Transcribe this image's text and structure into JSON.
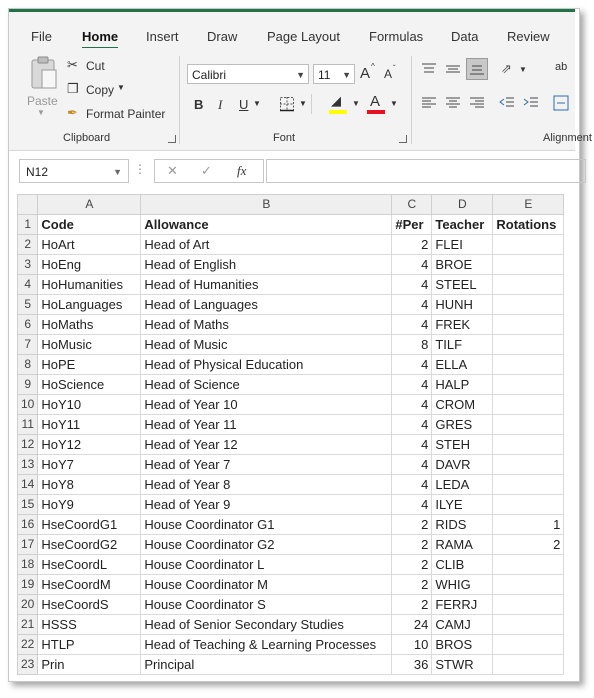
{
  "tabs": [
    "File",
    "Home",
    "Insert",
    "Draw",
    "Page Layout",
    "Formulas",
    "Data",
    "Review"
  ],
  "active_tab": "Home",
  "clipboard": {
    "paste_label": "Paste",
    "cut_label": "Cut",
    "copy_label": "Copy",
    "format_painter_label": "Format Painter",
    "group_label": "Clipboard"
  },
  "font": {
    "name": "Calibri",
    "size": "11",
    "grow_label": "A",
    "shrink_label": "A",
    "bold": "B",
    "italic": "I",
    "underline": "U",
    "font_color_label": "A",
    "group_label": "Font"
  },
  "alignment": {
    "group_label": "Alignment",
    "wrap_label": "ab"
  },
  "formula_bar": {
    "name_box": "N12",
    "fx_label": "fx",
    "formula": ""
  },
  "columns": [
    "A",
    "B",
    "C",
    "D",
    "E"
  ],
  "rows": [
    {
      "n": "1",
      "a": "Code",
      "b": "Allowance",
      "c": "#Per",
      "d": "Teacher",
      "e": "Rotations"
    },
    {
      "n": "2",
      "a": "HoArt",
      "b": "Head of Art",
      "c": "2",
      "d": "FLEI",
      "e": ""
    },
    {
      "n": "3",
      "a": "HoEng",
      "b": "Head of English",
      "c": "4",
      "d": "BROE",
      "e": ""
    },
    {
      "n": "4",
      "a": "HoHumanities",
      "b": "Head of Humanities",
      "c": "4",
      "d": "STEEL",
      "e": ""
    },
    {
      "n": "5",
      "a": "HoLanguages",
      "b": "Head of Languages",
      "c": "4",
      "d": "HUNH",
      "e": ""
    },
    {
      "n": "6",
      "a": "HoMaths",
      "b": "Head of Maths",
      "c": "4",
      "d": "FREK",
      "e": ""
    },
    {
      "n": "7",
      "a": "HoMusic",
      "b": "Head of Music",
      "c": "8",
      "d": "TILF",
      "e": ""
    },
    {
      "n": "8",
      "a": "HoPE",
      "b": "Head of Physical Education",
      "c": "4",
      "d": "ELLA",
      "e": ""
    },
    {
      "n": "9",
      "a": "HoScience",
      "b": "Head of Science",
      "c": "4",
      "d": "HALP",
      "e": ""
    },
    {
      "n": "10",
      "a": "HoY10",
      "b": "Head of Year 10",
      "c": "4",
      "d": "CROM",
      "e": ""
    },
    {
      "n": "11",
      "a": "HoY11",
      "b": "Head of Year 11",
      "c": "4",
      "d": "GRES",
      "e": ""
    },
    {
      "n": "12",
      "a": "HoY12",
      "b": "Head of Year 12",
      "c": "4",
      "d": "STEH",
      "e": ""
    },
    {
      "n": "13",
      "a": "HoY7",
      "b": "Head of Year 7",
      "c": "4",
      "d": "DAVR",
      "e": ""
    },
    {
      "n": "14",
      "a": "HoY8",
      "b": "Head of Year 8",
      "c": "4",
      "d": "LEDA",
      "e": ""
    },
    {
      "n": "15",
      "a": "HoY9",
      "b": "Head of Year 9",
      "c": "4",
      "d": "ILYE",
      "e": ""
    },
    {
      "n": "16",
      "a": "HseCoordG1",
      "b": "House Coordinator G1",
      "c": "2",
      "d": "RIDS",
      "e": "1"
    },
    {
      "n": "17",
      "a": "HseCoordG2",
      "b": "House Coordinator G2",
      "c": "2",
      "d": "RAMA",
      "e": "2"
    },
    {
      "n": "18",
      "a": "HseCoordL",
      "b": "House Coordinator L",
      "c": "2",
      "d": "CLIB",
      "e": ""
    },
    {
      "n": "19",
      "a": "HseCoordM",
      "b": "House Coordinator M",
      "c": "2",
      "d": "WHIG",
      "e": ""
    },
    {
      "n": "20",
      "a": "HseCoordS",
      "b": "House Coordinator S",
      "c": "2",
      "d": "FERRJ",
      "e": ""
    },
    {
      "n": "21",
      "a": "HSSS",
      "b": "Head of Senior Secondary Studies",
      "c": "24",
      "d": "CAMJ",
      "e": ""
    },
    {
      "n": "22",
      "a": "HTLP",
      "b": "Head of Teaching & Learning Processes",
      "c": "10",
      "d": "BROS",
      "e": ""
    },
    {
      "n": "23",
      "a": "Prin",
      "b": "Principal",
      "c": "36",
      "d": "STWR",
      "e": ""
    }
  ],
  "colors": {
    "accent": "#217346",
    "font_color_underline": "#e81123",
    "highlight": "#ffff00"
  }
}
